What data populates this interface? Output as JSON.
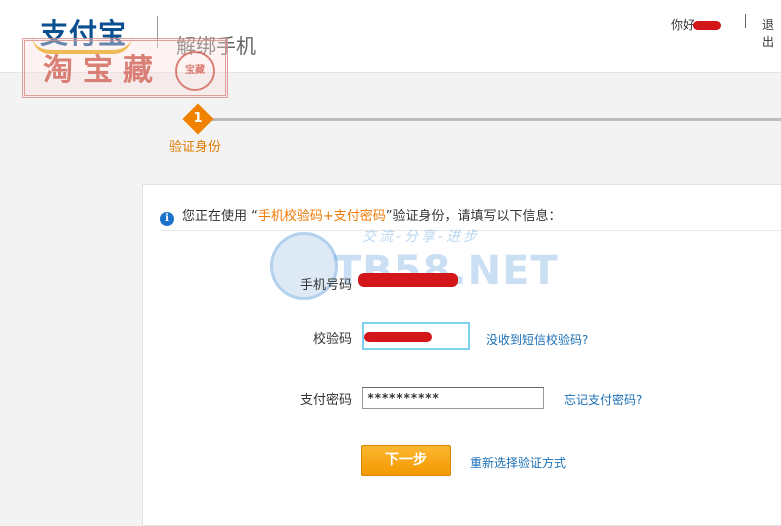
{
  "header": {
    "logo_text": "支付宝",
    "page_title": "解绑手机",
    "greeting": "你好",
    "logout_label": "退出"
  },
  "watermark_stamp": {
    "text": "淘宝藏",
    "seal": "宝藏"
  },
  "steps": [
    {
      "number": "1",
      "label": "验证身份",
      "active": true
    }
  ],
  "info": {
    "prefix": "您正在使用 “",
    "method": "手机校验码+支付密码",
    "suffix": "”验证身份，请填写以下信息："
  },
  "site_watermark": {
    "slogan": "交流-分享-进步",
    "brand": "TB58.NET"
  },
  "form": {
    "phone_label": "手机号码",
    "code_label": "校验码",
    "code_link": "没收到短信校验码?",
    "password_label": "支付密码",
    "password_value": "**********",
    "password_link": "忘记支付密码?",
    "next_button": "下一步",
    "reselect_link": "重新选择验证方式"
  },
  "colors": {
    "accent_orange": "#f08200",
    "link_blue": "#1a6fb5",
    "redaction_red": "#d2161a"
  }
}
